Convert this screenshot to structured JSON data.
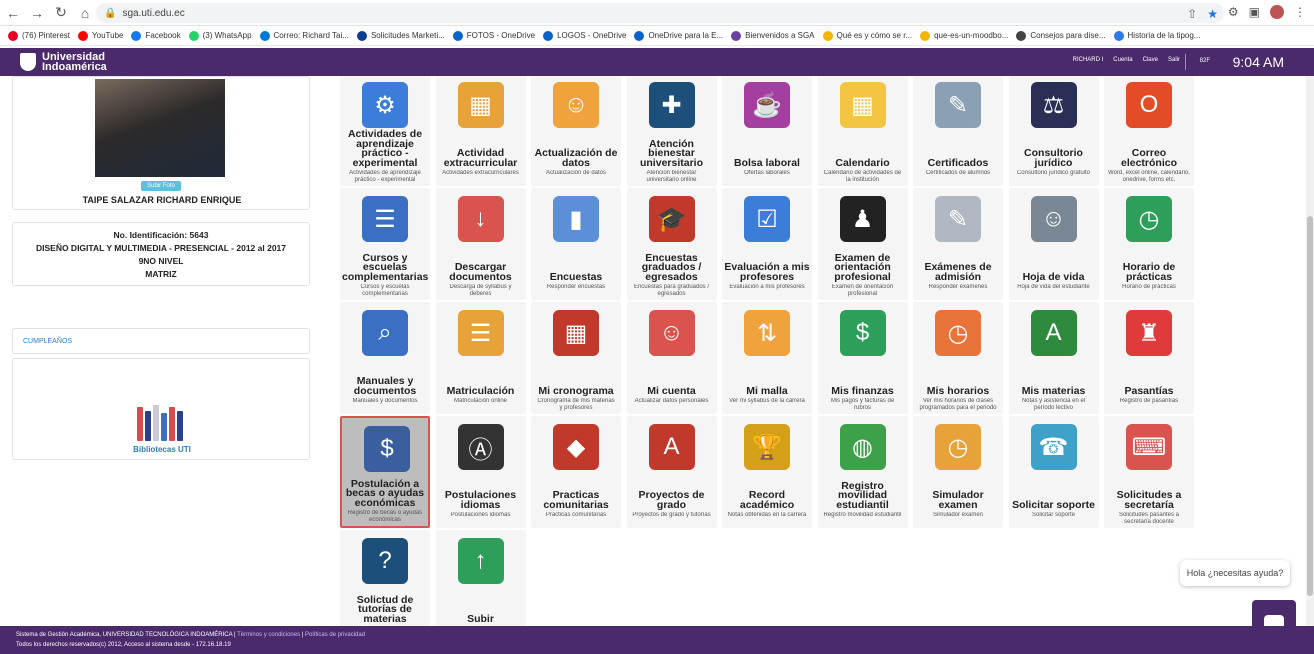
{
  "browser": {
    "url": "sga.uti.edu.ec",
    "bookmarks": [
      {
        "label": "(76) Pinterest",
        "color": "#e60023"
      },
      {
        "label": "YouTube",
        "color": "#ff0000"
      },
      {
        "label": "Facebook",
        "color": "#1877f2"
      },
      {
        "label": "(3) WhatsApp",
        "color": "#25d366"
      },
      {
        "label": "Correo: Richard Tai...",
        "color": "#0078d4"
      },
      {
        "label": "Solicitudes Marketi...",
        "color": "#0b3d91"
      },
      {
        "label": "FOTOS - OneDrive",
        "color": "#0a64c8"
      },
      {
        "label": "LOGOS - OneDrive",
        "color": "#0a64c8"
      },
      {
        "label": "OneDrive para la E...",
        "color": "#0a64c8"
      },
      {
        "label": "Bienvenidos a SGA",
        "color": "#6b3fa0"
      },
      {
        "label": "Qué es y cómo se r...",
        "color": "#f5b400"
      },
      {
        "label": "que-es-un-moodbo...",
        "color": "#f5b400"
      },
      {
        "label": "Consejos para dise...",
        "color": "#444444"
      },
      {
        "label": "Historia de la tipog...",
        "color": "#2c7be5"
      }
    ]
  },
  "header": {
    "brand_line1": "Universidad",
    "brand_line2": "Indoamérica",
    "user": "RICHARD I",
    "links": [
      "Cuenta",
      "Clave",
      "Salir"
    ],
    "temp": "82F",
    "time": "9:04 AM"
  },
  "profile": {
    "upload_label": "Subir Foto",
    "name": "TAIPE SALAZAR RICHARD ENRIQUE",
    "id_line": "No. Identificación: 5643",
    "career_line": "DISEÑO DIGITAL Y MULTIMEDIA - PRESENCIAL - 2012 al 2017",
    "level_line": "9NO NIVEL",
    "status_line": "MATRIZ"
  },
  "birthdays": {
    "label": "CUMPLEAÑOS"
  },
  "library": {
    "label": "Bibliotecas UTI"
  },
  "tiles": [
    {
      "title": "Actividades de aprendizaje práctico - experimental",
      "sub": "Actividades de aprendizaje práctico - experimental",
      "icon": "gears-icon",
      "color": "#3b7dd8"
    },
    {
      "title": "Actividad extracurricular",
      "sub": "Actividades extracurriculares",
      "icon": "presentation-icon",
      "color": "#e8a23a"
    },
    {
      "title": "Actualización de datos",
      "sub": "Actualización de datos",
      "icon": "folder-user-icon",
      "color": "#f0a23c"
    },
    {
      "title": "Atención bienestar universitario",
      "sub": "Atención bienestar universitario online",
      "icon": "medkit-icon",
      "color": "#1c4f7a"
    },
    {
      "title": "Bolsa laboral",
      "sub": "Ofertas laborales",
      "icon": "mug-icon",
      "color": "#a43fa0"
    },
    {
      "title": "Calendario",
      "sub": "Calendario de actividades de la institución",
      "icon": "calendar-icon",
      "color": "#f4c542"
    },
    {
      "title": "Certificados",
      "sub": "Certificados de alumnos",
      "icon": "certificate-icon",
      "color": "#8aa0b5"
    },
    {
      "title": "Consultorio jurídico",
      "sub": "Consultorio jurídico gratuito",
      "icon": "legal-icon",
      "color": "#2a2f55"
    },
    {
      "title": "Correo electrónico",
      "sub": "Word, excel online, calendario, onedrive, forms etc.",
      "icon": "office-icon",
      "color": "#e34c26"
    },
    {
      "title": "Cursos y escuelas complementarias",
      "sub": "Cursos y escuelas complementarias",
      "icon": "course-icon",
      "color": "#3a6fc4"
    },
    {
      "title": "Descargar documentos",
      "sub": "Descarga de syllabus y deberes",
      "icon": "download-icon",
      "color": "#d9534f"
    },
    {
      "title": "Encuestas",
      "sub": "Responder encuestas",
      "icon": "chart-icon",
      "color": "#5b8fd8"
    },
    {
      "title": "Encuestas graduados / egresados",
      "sub": "Encuestas para graduados / egresados",
      "icon": "graduation-icon",
      "color": "#c0392b"
    },
    {
      "title": "Evaluación a mis profesores",
      "sub": "Evaluación a mis profesores",
      "icon": "evaluation-icon",
      "color": "#3b7dd8"
    },
    {
      "title": "Examen de orientación profesional",
      "sub": "Examen de orientación profesional",
      "icon": "orientation-icon",
      "color": "#222222"
    },
    {
      "title": "Exámenes de admisión",
      "sub": "Responder exámenes",
      "icon": "exam-icon",
      "color": "#b0b8c4"
    },
    {
      "title": "Hoja de vida",
      "sub": "Hoja de vida del estudiante",
      "icon": "resume-icon",
      "color": "#7a8794"
    },
    {
      "title": "Horario de prácticas",
      "sub": "Horario de prácticas",
      "icon": "clock-icon",
      "color": "#2e9e5b"
    },
    {
      "title": "Manuales y documentos",
      "sub": "Manuales y documentos",
      "icon": "manual-icon",
      "color": "#3a6fc4"
    },
    {
      "title": "Matriculación",
      "sub": "Matriculación online",
      "icon": "clipboard-icon",
      "color": "#e8a23a"
    },
    {
      "title": "Mi cronograma",
      "sub": "Cronograma de mis materias y profesores",
      "icon": "schedule-icon",
      "color": "#c0392b"
    },
    {
      "title": "Mi cuenta",
      "sub": "Actualizar datos personales",
      "icon": "account-icon",
      "color": "#d9534f"
    },
    {
      "title": "Mi malla",
      "sub": "Ver mi syllabus de la carrera",
      "icon": "flow-icon",
      "color": "#f0a23c"
    },
    {
      "title": "Mis finanzas",
      "sub": "Mis pagos y facturas de rubros",
      "icon": "money-icon",
      "color": "#2e9e5b"
    },
    {
      "title": "Mis horarios",
      "sub": "Ver mis horarios de clases programados para el periodo",
      "icon": "clock-icon",
      "color": "#e8743a"
    },
    {
      "title": "Mis materias",
      "sub": "Notas y asistencia en el período lectivo",
      "icon": "book-icon",
      "color": "#2e8b3d"
    },
    {
      "title": "Pasantías",
      "sub": "Registro de pasantías",
      "icon": "chair-icon",
      "color": "#e03b3b"
    },
    {
      "title": "Postulación a becas o ayudas económicas",
      "sub": "Registro de becas o ayudas económicas",
      "icon": "scholarship-icon",
      "color": "#3a5f9f"
    },
    {
      "title": "Postulaciones idiomas",
      "sub": "Postulaciones idiomas",
      "icon": "language-icon",
      "color": "#333333"
    },
    {
      "title": "Practicas comunitarias",
      "sub": "Practicas comunitarias",
      "icon": "cube-icon",
      "color": "#c0392b"
    },
    {
      "title": "Proyectos de grado",
      "sub": "Proyectos de grado y tutorías",
      "icon": "project-icon",
      "color": "#c0392b"
    },
    {
      "title": "Record académico",
      "sub": "Notas obtenidas en la carrera",
      "icon": "trophy-icon",
      "color": "#d4a017"
    },
    {
      "title": "Registro movilidad estudiantil",
      "sub": "Registro movilidad estudiantil",
      "icon": "globe-icon",
      "color": "#3fa04a"
    },
    {
      "title": "Simulador examen",
      "sub": "Simulador examen",
      "icon": "simulator-icon",
      "color": "#e8a23a"
    },
    {
      "title": "Solicitar soporte",
      "sub": "Solicitar soporte",
      "icon": "support-icon",
      "color": "#3fa0c8"
    },
    {
      "title": "Solicitudes a secretaría",
      "sub": "Solicitudes pasantes a secretaría docente",
      "icon": "typewriter-icon",
      "color": "#d9534f"
    },
    {
      "title": "Solictud de tutorías de materias",
      "sub": "",
      "icon": "tutoring-icon",
      "color": "#1c4f7a"
    },
    {
      "title": "Subir",
      "sub": "",
      "icon": "upload-icon",
      "color": "#2e9e5b"
    }
  ],
  "chat": {
    "prompt": "Hola ¿necesitas ayuda?"
  },
  "footer": {
    "line1_prefix": "Sistema de Gestión Académica, UNIVERSIDAD TECNOLÓGICA INDOAMÉRICA |",
    "line1_link1": "Términos y condiciones",
    "line1_link2": "Políticas de privacidad",
    "line2": "Todos los derechos reservados(c) 2012, Acceso al sistema desde - 172.16.18.19"
  }
}
